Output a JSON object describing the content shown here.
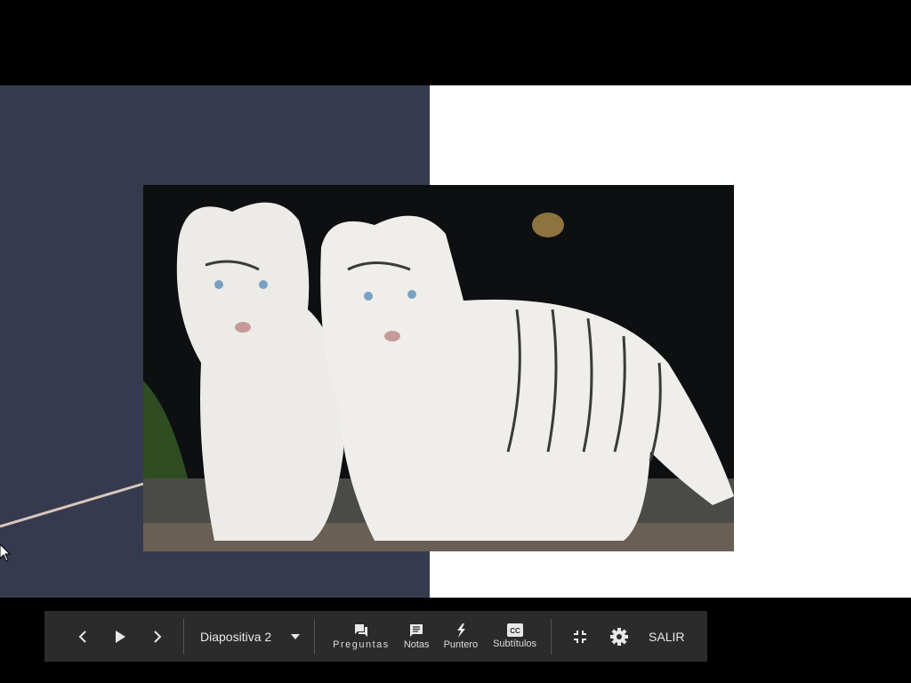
{
  "toolbar": {
    "slide_selector": "Diapositiva 2",
    "questions_label": "Preguntas",
    "notes_label": "Notas",
    "pointer_label": "Puntero",
    "captions_label": "Subtítulos",
    "exit_label": "SALIR"
  },
  "colors": {
    "slide_left": "#363a4f",
    "toolbar": "#2b2b2b"
  }
}
